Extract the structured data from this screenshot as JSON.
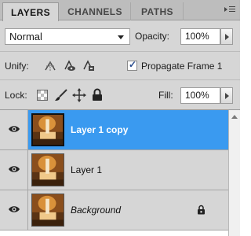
{
  "tabs": [
    {
      "label": "LAYERS",
      "active": true
    },
    {
      "label": "CHANNELS",
      "active": false
    },
    {
      "label": "PATHS",
      "active": false
    }
  ],
  "blend": {
    "mode": "Normal",
    "opacity_label": "Opacity:",
    "opacity_value": "100%"
  },
  "unify": {
    "label": "Unify:",
    "propagate_label": "Propagate Frame 1",
    "propagate_checked": true
  },
  "lock": {
    "label": "Lock:",
    "fill_label": "Fill:",
    "fill_value": "100%"
  },
  "icons": {
    "panel_menu": "panel-menu-icon",
    "unify_position": "unify-position-icon",
    "unify_visibility": "unify-visibility-icon",
    "unify_style": "unify-style-icon",
    "lock_transparent": "lock-transparent-pixels-icon",
    "lock_image": "lock-image-pixels-icon",
    "lock_position": "lock-position-icon",
    "lock_all": "lock-all-icon",
    "visibility": "eye-icon",
    "layer_locked": "lock-icon"
  },
  "layers": [
    {
      "name": "Layer 1 copy",
      "selected": true,
      "visible": true,
      "locked": false,
      "italic": false
    },
    {
      "name": "Layer 1",
      "selected": false,
      "visible": true,
      "locked": false,
      "italic": false
    },
    {
      "name": "Background",
      "selected": false,
      "visible": true,
      "locked": true,
      "italic": true
    }
  ],
  "colors": {
    "selection": "#3a9af0",
    "panel_bg": "#d6d6d6",
    "tab_bar": "#bdbdbd"
  }
}
